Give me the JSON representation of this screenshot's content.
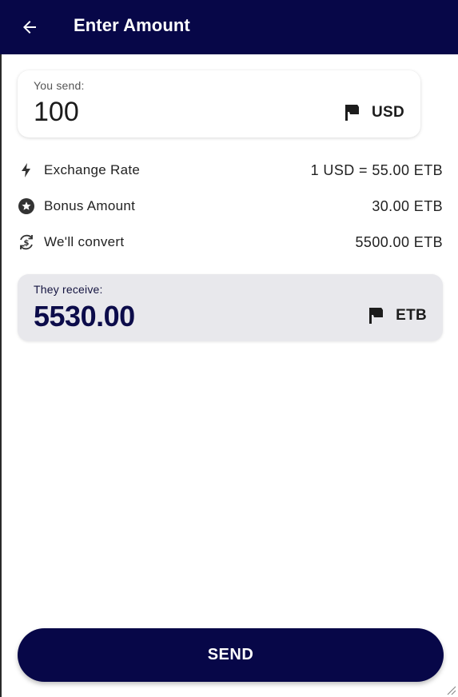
{
  "app_bar": {
    "title": "Enter Amount",
    "back_icon": "arrow-left-icon",
    "background": "#070748"
  },
  "send_card": {
    "label": "You send:",
    "amount": "100",
    "currency_code": "USD",
    "currency_icon": "flag-icon"
  },
  "details": [
    {
      "icon": "flash-icon",
      "label": "Exchange Rate",
      "value": "1 USD = 55.00 ETB"
    },
    {
      "icon": "star-circle-icon",
      "label": "Bonus Amount",
      "value": "30.00 ETB"
    },
    {
      "icon": "currency-exchange-icon",
      "label": "We'll convert",
      "value": "5500.00 ETB"
    }
  ],
  "receive_card": {
    "label": "They receive:",
    "amount": "5530.00",
    "currency_code": "ETB",
    "currency_icon": "flag-icon",
    "background": "#e8e8ec"
  },
  "send_button": {
    "label": "SEND",
    "background": "#070748"
  }
}
